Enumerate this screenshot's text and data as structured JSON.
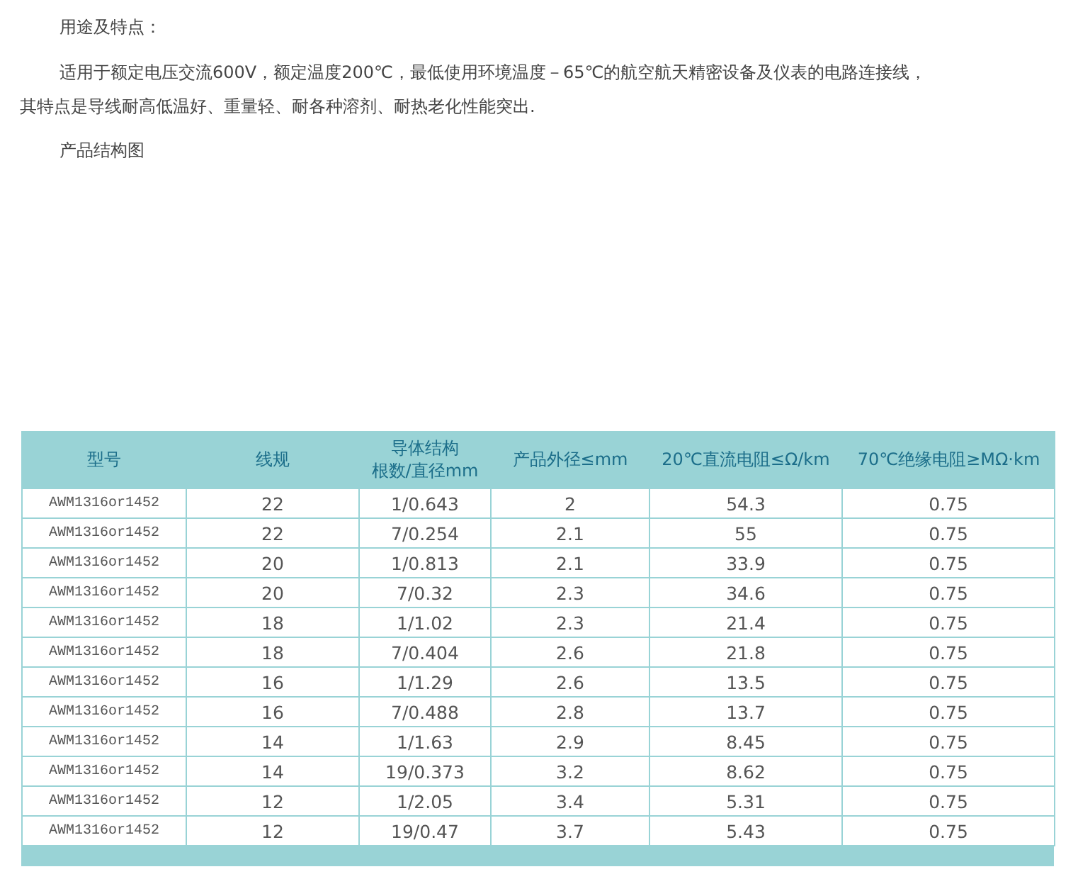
{
  "heading": "用途及特点：",
  "paragraph": "适用于额定电压交流600V，额定温度200℃，最低使用环境温度－65℃的航空航天精密设备及仪表的电路连接线，其特点是导线耐高低温好、重量轻、耐各种溶剂、耐热老化性能突出.",
  "figure_caption": "产品结构图",
  "table": {
    "columns": [
      {
        "label": "型号"
      },
      {
        "label": "线规"
      },
      {
        "label": "导体结构",
        "sublabel": "根数/直径mm"
      },
      {
        "label": "产品外径≤mm"
      },
      {
        "label": "20℃直流电阻≤Ω/km"
      },
      {
        "label": "70℃绝缘电阻≥MΩ·km"
      }
    ],
    "rows": [
      [
        "AWM1316or1452",
        "22",
        "1/0.643",
        "2",
        "54.3",
        "0.75"
      ],
      [
        "AWM1316or1452",
        "22",
        "7/0.254",
        "2.1",
        "55",
        "0.75"
      ],
      [
        "AWM1316or1452",
        "20",
        "1/0.813",
        "2.1",
        "33.9",
        "0.75"
      ],
      [
        "AWM1316or1452",
        "20",
        "7/0.32",
        "2.3",
        "34.6",
        "0.75"
      ],
      [
        "AWM1316or1452",
        "18",
        "1/1.02",
        "2.3",
        "21.4",
        "0.75"
      ],
      [
        "AWM1316or1452",
        "18",
        "7/0.404",
        "2.6",
        "21.8",
        "0.75"
      ],
      [
        "AWM1316or1452",
        "16",
        "1/1.29",
        "2.6",
        "13.5",
        "0.75"
      ],
      [
        "AWM1316or1452",
        "16",
        "7/0.488",
        "2.8",
        "13.7",
        "0.75"
      ],
      [
        "AWM1316or1452",
        "14",
        "1/1.63",
        "2.9",
        "8.45",
        "0.75"
      ],
      [
        "AWM1316or1452",
        "14",
        "19/0.373",
        "3.2",
        "8.62",
        "0.75"
      ],
      [
        "AWM1316or1452",
        "12",
        "1/2.05",
        "3.4",
        "5.31",
        "0.75"
      ],
      [
        "AWM1316or1452",
        "12",
        "19/0.47",
        "3.7",
        "5.43",
        "0.75"
      ]
    ]
  }
}
